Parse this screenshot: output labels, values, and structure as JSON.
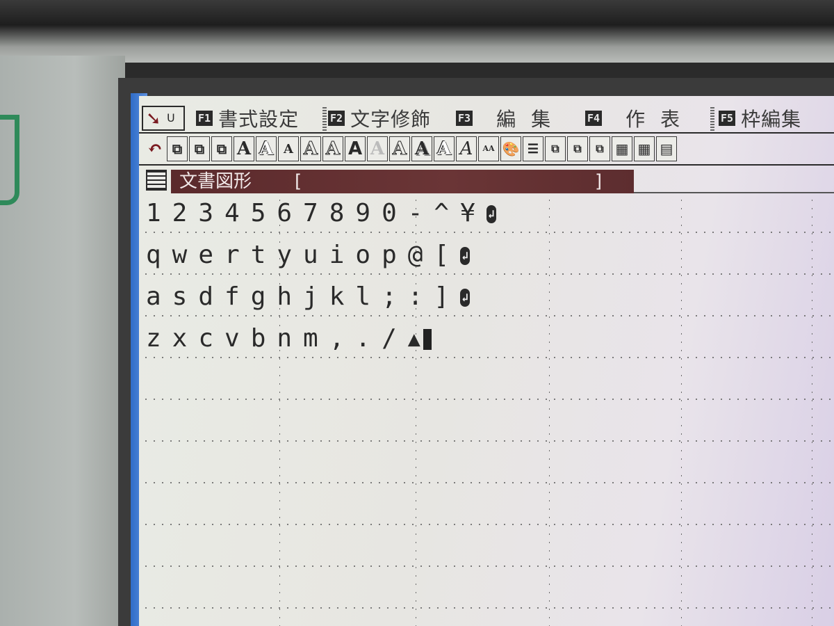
{
  "menu": {
    "pointer_label": "U",
    "items": [
      {
        "key": "F1",
        "label": "書式設定"
      },
      {
        "key": "F2",
        "label": "文字修飾"
      },
      {
        "key": "F3",
        "label": "編集"
      },
      {
        "key": "F4",
        "label": "作表"
      },
      {
        "key": "F5",
        "label": "枠編集"
      }
    ]
  },
  "toolbar": {
    "letter": "A",
    "small_letters": "AA"
  },
  "mode": {
    "label": "文書図形",
    "bracket_open": "[",
    "bracket_close": "]"
  },
  "document": {
    "lines": [
      "1234567890-^¥",
      "qwertyuiop@[",
      "asdfghjkl;:]",
      "zxcvbnm,./"
    ],
    "return_glyph": "↲",
    "end_mark": "▲"
  }
}
